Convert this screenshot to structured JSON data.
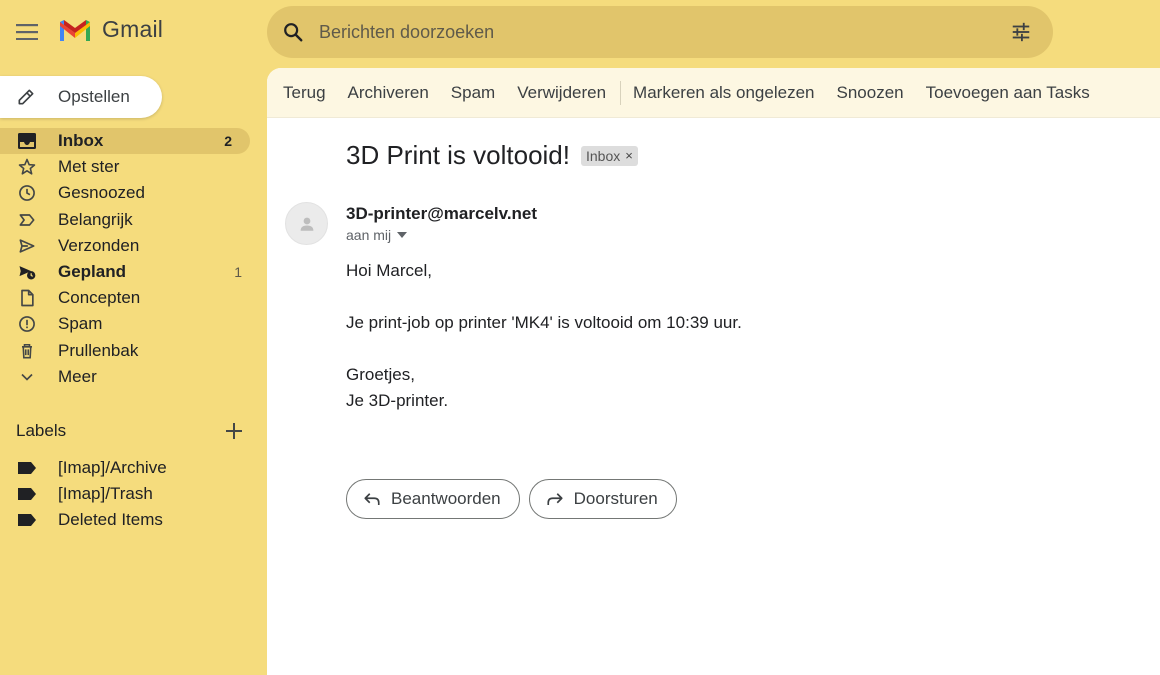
{
  "header": {
    "app_name": "Gmail",
    "search_placeholder": "Berichten doorzoeken"
  },
  "compose": {
    "label": "Opstellen"
  },
  "nav": [
    {
      "label": "Inbox",
      "count": "2",
      "icon": "inbox-icon"
    },
    {
      "label": "Met ster",
      "count": "",
      "icon": "star-icon"
    },
    {
      "label": "Gesnoozed",
      "count": "",
      "icon": "clock-icon"
    },
    {
      "label": "Belangrijk",
      "count": "",
      "icon": "important-icon"
    },
    {
      "label": "Verzonden",
      "count": "",
      "icon": "send-icon"
    },
    {
      "label": "Gepland",
      "count": "1",
      "icon": "scheduled-icon"
    },
    {
      "label": "Concepten",
      "count": "",
      "icon": "draft-icon"
    },
    {
      "label": "Spam",
      "count": "",
      "icon": "spam-icon"
    },
    {
      "label": "Prullenbak",
      "count": "",
      "icon": "trash-icon"
    },
    {
      "label": "Meer",
      "count": "",
      "icon": "chevron-down-icon"
    }
  ],
  "labels": {
    "title": "Labels",
    "items": [
      "[Imap]/Archive",
      "[Imap]/Trash",
      "Deleted Items"
    ]
  },
  "toolbar": {
    "back": "Terug",
    "archive": "Archiveren",
    "spam": "Spam",
    "delete": "Verwijderen",
    "mark_unread": "Markeren als ongelezen",
    "snooze": "Snoozen",
    "add_tasks": "Toevoegen aan Tasks"
  },
  "message": {
    "subject": "3D Print is voltooid!",
    "label_chip": "Inbox",
    "chip_close": "×",
    "sender": "3D-printer@marcelv.net",
    "to": "aan mij",
    "greeting": "Hoi Marcel,",
    "line1": "Je print-job op printer 'MK4' is voltooid om 10:39 uur.",
    "closing": "Groetjes,",
    "signature": "Je 3D-printer."
  },
  "actions": {
    "reply": "Beantwoorden",
    "forward": "Doorsturen"
  },
  "colors": {
    "background": "#f5dc7d",
    "search": "#e1c56b",
    "active_item": "#e1c56b",
    "toolbar": "#fdf7e2"
  }
}
